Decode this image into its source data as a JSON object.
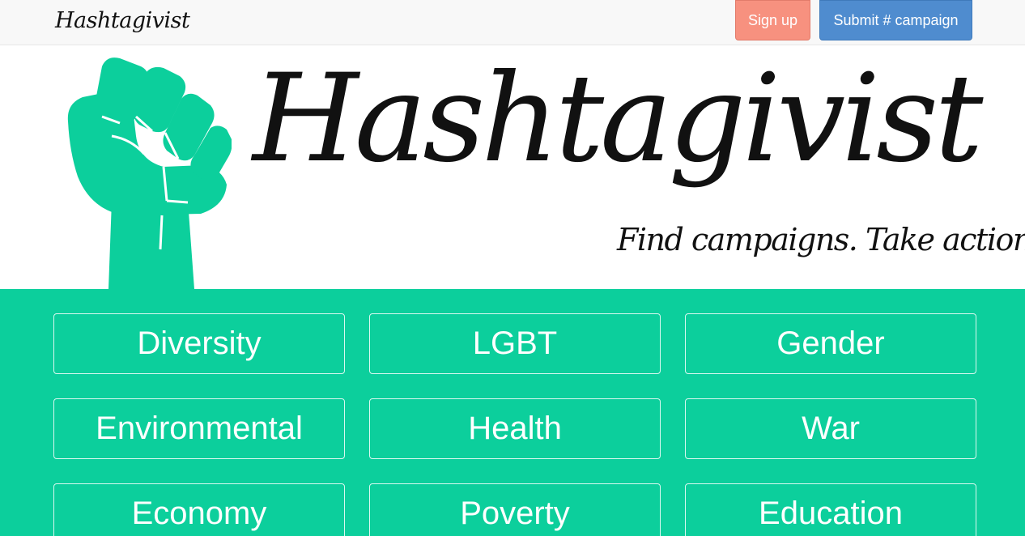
{
  "navbar": {
    "brand": "Hashtagivist",
    "signup_label": "Sign up",
    "submit_label": "Submit # campaign",
    "signup_color": "#f7917f",
    "submit_color": "#4f8ccf"
  },
  "hero": {
    "title": "Hashtagivist",
    "tagline": "Find campaigns. Take action.",
    "logo_icon": "raised-fist-icon",
    "accent_color": "#0ccf9c"
  },
  "categories": [
    {
      "label": "Diversity"
    },
    {
      "label": "LGBT"
    },
    {
      "label": "Gender"
    },
    {
      "label": "Environmental"
    },
    {
      "label": "Health"
    },
    {
      "label": "War"
    },
    {
      "label": "Economy"
    },
    {
      "label": "Poverty"
    },
    {
      "label": "Education"
    }
  ]
}
